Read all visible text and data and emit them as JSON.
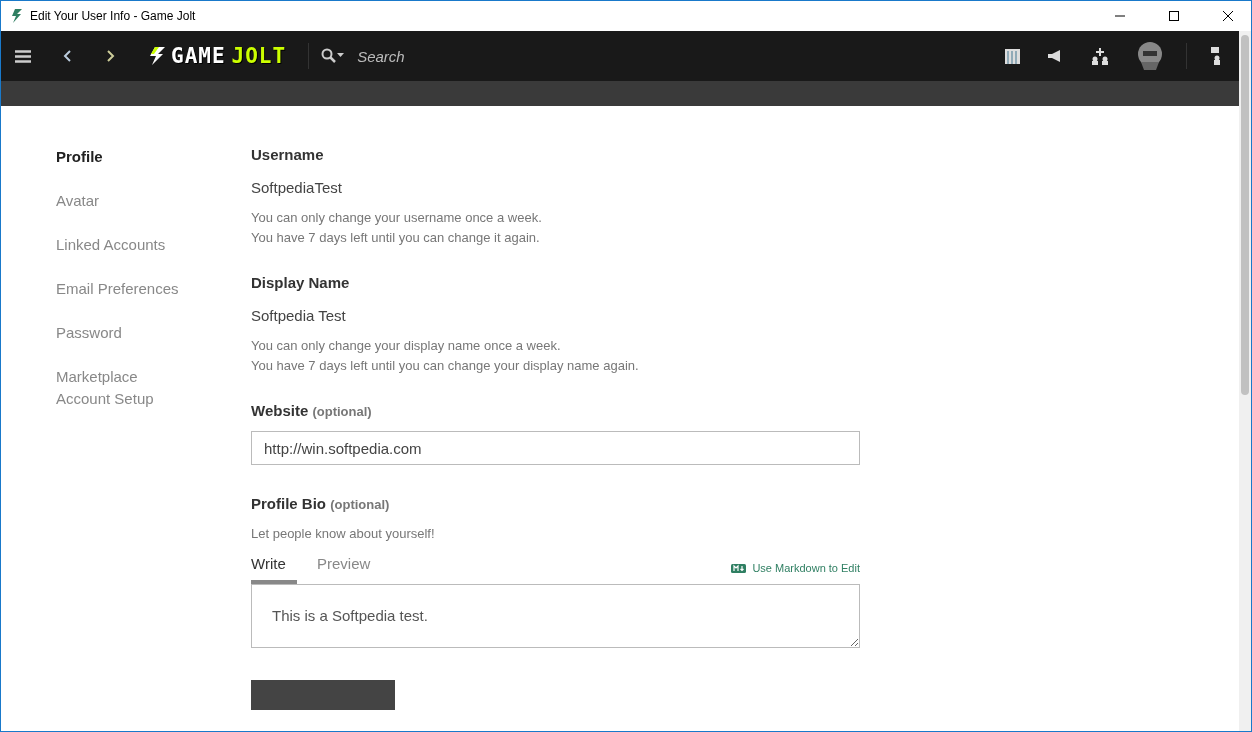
{
  "window": {
    "title": "Edit Your User Info - Game Jolt"
  },
  "navbar": {
    "logo": {
      "word_1": "GAME",
      "word_2": "JOLT"
    },
    "search": {
      "placeholder": "Search"
    }
  },
  "sidebar": {
    "items": [
      {
        "label": "Profile",
        "selected": true
      },
      {
        "label": "Avatar",
        "selected": false
      },
      {
        "label": "Linked Accounts",
        "selected": false
      },
      {
        "label": "Email Preferences",
        "selected": false
      },
      {
        "label": "Password",
        "selected": false
      },
      {
        "label": "Marketplace Account Setup",
        "selected": false
      }
    ]
  },
  "form": {
    "username": {
      "label": "Username",
      "value": "SoftpediaTest",
      "notes": [
        "You can only change your username once a week.",
        "You have 7 days left until you can change it again."
      ]
    },
    "display_name": {
      "label": "Display Name",
      "value": "Softpedia Test",
      "notes": [
        "You can only change your display name once a week.",
        "You have 7 days left until you can change your display name again."
      ]
    },
    "website": {
      "label": "Website",
      "optional": "(optional)",
      "value": "http://win.softpedia.com"
    },
    "bio": {
      "label": "Profile Bio",
      "optional": "(optional)",
      "hint": "Let people know about yourself!",
      "tabs": [
        {
          "label": "Write",
          "selected": true
        },
        {
          "label": "Preview",
          "selected": false
        }
      ],
      "markdown_link": "Use Markdown to Edit",
      "value": "This is a Softpedia test."
    }
  }
}
